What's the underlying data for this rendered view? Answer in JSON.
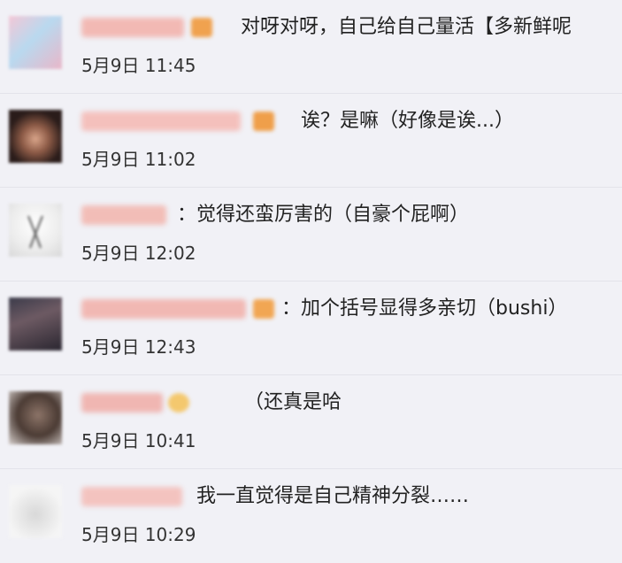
{
  "comments": [
    {
      "username": "",
      "text": "对呀对呀，自己给自己量活【多新鲜呢",
      "timestamp": "5月9日 11:45"
    },
    {
      "username": "",
      "text": "诶？是嘛（好像是诶...）",
      "timestamp": "5月9日 11:02"
    },
    {
      "username": "",
      "text": "：觉得还蛮厉害的（自豪个屁啊）",
      "timestamp": "5月9日 12:02"
    },
    {
      "username": "",
      "text": "：加个括号显得多亲切（bushi）",
      "timestamp": "5月9日 12:43"
    },
    {
      "username": "",
      "text": "（还真是哈",
      "timestamp": "5月9日 10:41"
    },
    {
      "username": "",
      "text": "我一直觉得是自己精神分裂……",
      "timestamp": "5月9日 10:29"
    }
  ]
}
